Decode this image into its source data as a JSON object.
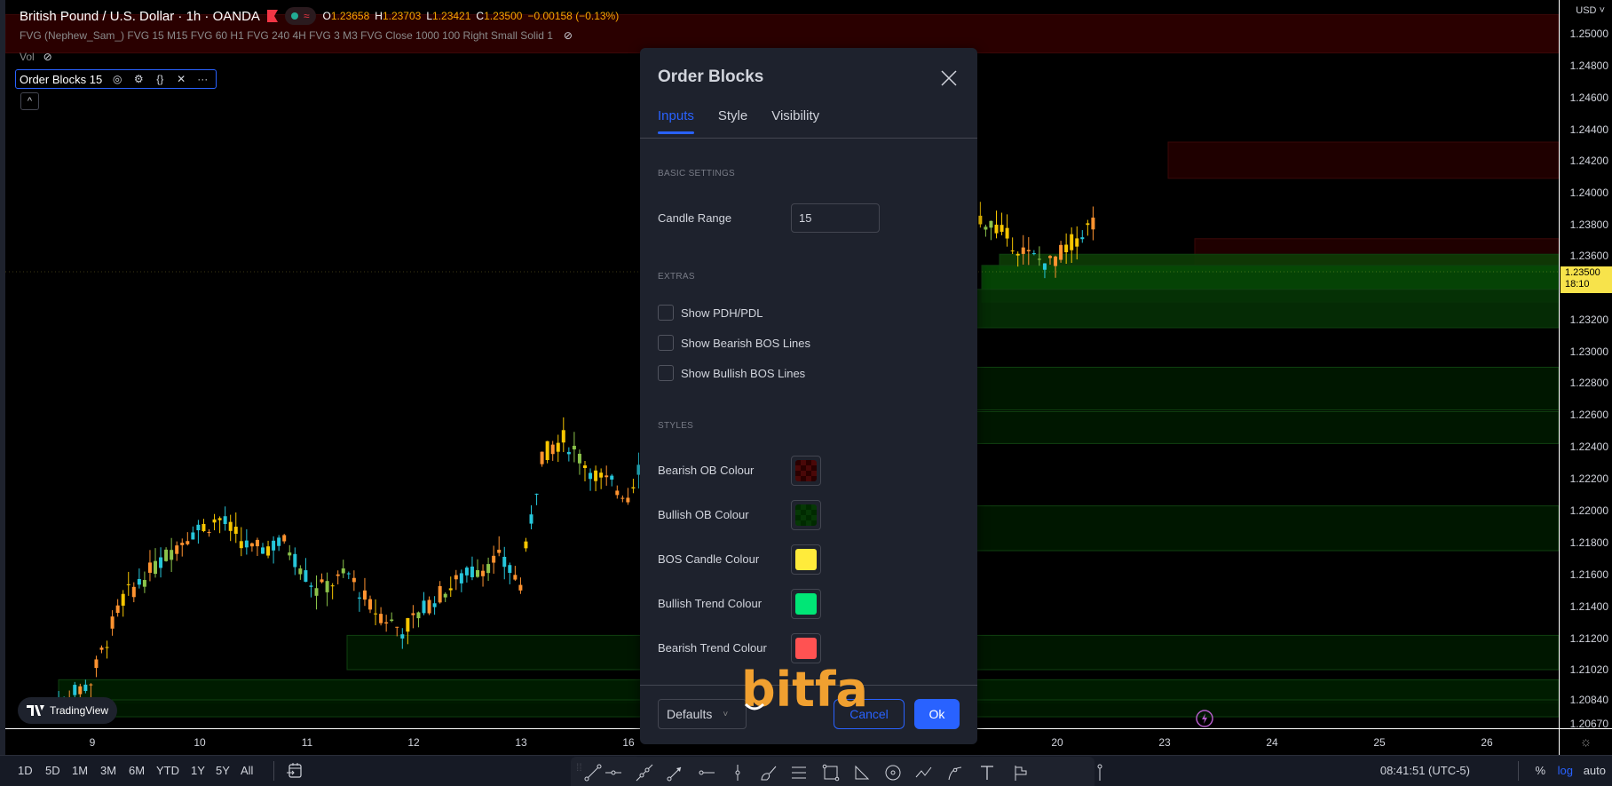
{
  "header": {
    "symbol_title": "British Pound / U.S. Dollar · 1h · OANDA",
    "ohlc": {
      "o_label": "O",
      "o": "1.23658",
      "h_label": "H",
      "h": "1.23703",
      "l_label": "L",
      "l": "1.23421",
      "c_label": "C",
      "c": "1.23500",
      "change": "−0.00158 (−0.13%)"
    }
  },
  "indicators": {
    "fvg": "FVG (Nephew_Sam_) FVG 15 M15 FVG 60 H1 FVG 240 4H FVG 3 M3 FVG Close 1000 100 Right Small Solid 1",
    "vol": "Vol",
    "order_blocks": "Order Blocks 15"
  },
  "price_axis": {
    "currency": "USD",
    "labels": [
      "1.25000",
      "1.24800",
      "1.24600",
      "1.24400",
      "1.24200",
      "1.24000",
      "1.23800",
      "1.23600",
      "1.23200",
      "1.23000",
      "1.22800",
      "1.22600",
      "1.22400",
      "1.22200",
      "1.22000",
      "1.21800",
      "1.21600",
      "1.21400",
      "1.21200",
      "1.21020",
      "1.20840",
      "1.20670"
    ],
    "last_price": "1.23500",
    "countdown": "18:10"
  },
  "time_axis": {
    "labels": [
      "9",
      "10",
      "11",
      "12",
      "13",
      "16",
      "20",
      "23",
      "24",
      "25",
      "26"
    ]
  },
  "bottom_bar": {
    "ranges": [
      "1D",
      "5D",
      "1M",
      "3M",
      "6M",
      "YTD",
      "1Y",
      "5Y",
      "All"
    ],
    "clock": "08:41:51 (UTC-5)",
    "percent": "%",
    "log": "log",
    "auto": "auto"
  },
  "drawing_tools": [
    "trend-line",
    "horizontal-ray",
    "extended-line",
    "arrow-line",
    "horizontal-line",
    "vertical-line",
    "brush",
    "parallel-channel",
    "rectangle",
    "triangle",
    "circle",
    "path",
    "arc",
    "text",
    "long-position",
    "anchored-vwap"
  ],
  "branding": {
    "tradingview": "TradingView",
    "watermark": "bitfa"
  },
  "dialog": {
    "title": "Order Blocks",
    "tabs": [
      {
        "label": "Inputs",
        "active": true
      },
      {
        "label": "Style",
        "active": false
      },
      {
        "label": "Visibility",
        "active": false
      }
    ],
    "sections": {
      "basic": "BASIC SETTINGS",
      "extras": "EXTRAS",
      "styles": "STYLES"
    },
    "candle_range_label": "Candle Range",
    "candle_range_value": "15",
    "checkboxes": [
      {
        "label": "Show PDH/PDL",
        "checked": false
      },
      {
        "label": "Show Bearish BOS Lines",
        "checked": false
      },
      {
        "label": "Show Bullish BOS Lines",
        "checked": false
      }
    ],
    "colours": [
      {
        "label": "Bearish OB Colour",
        "color": "#3a0000",
        "transparent": true
      },
      {
        "label": "Bullish OB Colour",
        "color": "#003a00",
        "transparent": true
      },
      {
        "label": "BOS Candle Colour",
        "color": "#ffeb3b",
        "transparent": false
      },
      {
        "label": "Bullish Trend Colour",
        "color": "#00e676",
        "transparent": false
      },
      {
        "label": "Bearish Trend Colour",
        "color": "#ff5252",
        "transparent": false
      }
    ],
    "defaults_label": "Defaults",
    "cancel_label": "Cancel",
    "ok_label": "Ok"
  },
  "chart_data": {
    "type": "candlestick",
    "title": "British Pound / U.S. Dollar · 1h · OANDA",
    "ylim": [
      1.2067,
      1.2515
    ],
    "x_ticks": [
      "9",
      "10",
      "11",
      "12",
      "13",
      "16",
      "20",
      "23",
      "24",
      "25",
      "26"
    ],
    "y_ticks": [
      1.25,
      1.248,
      1.246,
      1.244,
      1.242,
      1.24,
      1.238,
      1.236,
      1.232,
      1.23,
      1.228,
      1.226,
      1.224,
      1.222,
      1.22,
      1.218,
      1.216,
      1.214,
      1.212,
      1.2102,
      1.2084,
      1.2067
    ],
    "last_close": 1.235,
    "bearish_zones": [
      [
        1.2488,
        1.2512
      ],
      [
        1.2409,
        1.2432
      ],
      [
        1.2353,
        1.2371
      ]
    ],
    "bullish_zones": [
      [
        1.235,
        1.2361
      ],
      [
        1.2331,
        1.2354
      ],
      [
        1.2315,
        1.2339
      ],
      [
        1.2263,
        1.229
      ],
      [
        1.2242,
        1.2262
      ],
      [
        1.2175,
        1.2203
      ],
      [
        1.2102,
        1.2122
      ],
      [
        1.2082,
        1.2096
      ],
      [
        1.2072,
        1.2084
      ]
    ],
    "series_anchor_points": [
      [
        0,
        1.2075
      ],
      [
        8,
        1.2095
      ],
      [
        14,
        1.2145
      ],
      [
        20,
        1.2165
      ],
      [
        26,
        1.2185
      ],
      [
        32,
        1.2195
      ],
      [
        38,
        1.2175
      ],
      [
        44,
        1.218
      ],
      [
        50,
        1.215
      ],
      [
        56,
        1.216
      ],
      [
        60,
        1.214
      ],
      [
        66,
        1.2125
      ],
      [
        72,
        1.2145
      ],
      [
        78,
        1.216
      ],
      [
        84,
        1.217
      ],
      [
        88,
        1.2155
      ],
      [
        92,
        1.2235
      ],
      [
        96,
        1.2245
      ],
      [
        102,
        1.2222
      ],
      [
        108,
        1.221
      ],
      [
        112,
        1.2245
      ],
      [
        118,
        1.228
      ],
      [
        124,
        1.2252
      ],
      [
        132,
        1.2265
      ],
      [
        140,
        1.227
      ],
      [
        146,
        1.2315
      ],
      [
        152,
        1.2355
      ],
      [
        158,
        1.2375
      ],
      [
        164,
        1.239
      ],
      [
        170,
        1.2378
      ],
      [
        176,
        1.236
      ],
      [
        180,
        1.2355
      ],
      [
        186,
        1.2375
      ],
      [
        192,
        1.2395
      ],
      [
        198,
        1.242
      ],
      [
        202,
        1.243
      ],
      [
        206,
        1.242
      ],
      [
        210,
        1.239
      ],
      [
        214,
        1.235
      ]
    ]
  }
}
